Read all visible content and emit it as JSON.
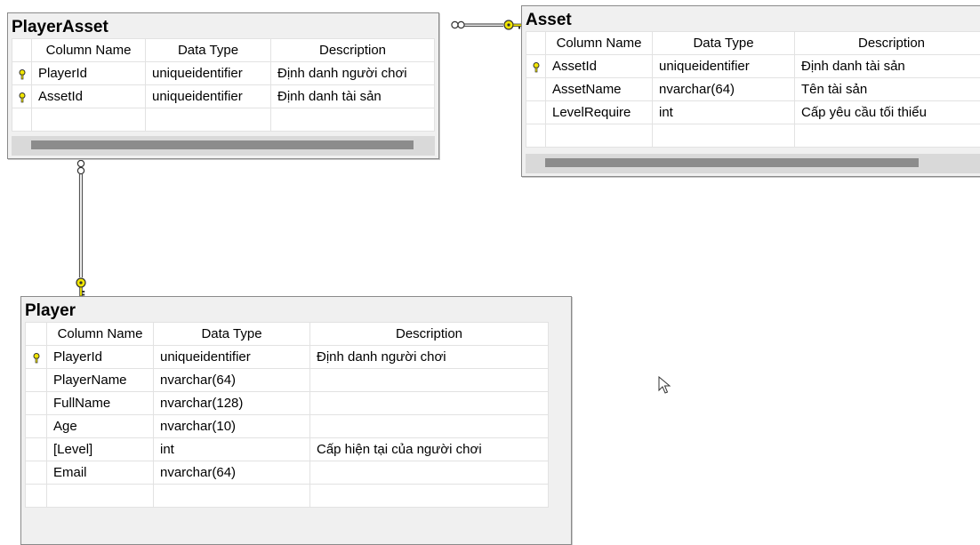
{
  "headers": {
    "col_name": "Column Name",
    "data_type": "Data Type",
    "description": "Description"
  },
  "tables": {
    "player_asset": {
      "title": "PlayerAsset",
      "rows": [
        {
          "key": true,
          "name": "PlayerId",
          "type": "uniqueidentifier",
          "desc": "Định danh người chơi"
        },
        {
          "key": true,
          "name": "AssetId",
          "type": "uniqueidentifier",
          "desc": "Định danh tài sản"
        },
        {
          "key": false,
          "name": "",
          "type": "",
          "desc": ""
        }
      ]
    },
    "asset": {
      "title": "Asset",
      "rows": [
        {
          "key": true,
          "name": "AssetId",
          "type": "uniqueidentifier",
          "desc": "Định danh tài sản"
        },
        {
          "key": false,
          "name": "AssetName",
          "type": "nvarchar(64)",
          "desc": "Tên tài sản"
        },
        {
          "key": false,
          "name": "LevelRequire",
          "type": "int",
          "desc": "Cấp yêu cầu tối thiểu"
        },
        {
          "key": false,
          "name": "",
          "type": "",
          "desc": ""
        }
      ]
    },
    "player": {
      "title": "Player",
      "rows": [
        {
          "key": true,
          "name": "PlayerId",
          "type": "uniqueidentifier",
          "desc": "Định danh người chơi"
        },
        {
          "key": false,
          "name": "PlayerName",
          "type": "nvarchar(64)",
          "desc": ""
        },
        {
          "key": false,
          "name": "FullName",
          "type": "nvarchar(128)",
          "desc": ""
        },
        {
          "key": false,
          "name": "Age",
          "type": "nvarchar(10)",
          "desc": ""
        },
        {
          "key": false,
          "name": "[Level]",
          "type": "int",
          "desc": "Cấp hiện tại của người chơi"
        },
        {
          "key": false,
          "name": "Email",
          "type": "nvarchar(64)",
          "desc": ""
        },
        {
          "key": false,
          "name": "",
          "type": "",
          "desc": ""
        }
      ]
    }
  },
  "relationships": [
    {
      "from": "PlayerAsset",
      "to": "Asset",
      "many_end": "PlayerAsset",
      "one_end": "Asset"
    },
    {
      "from": "PlayerAsset",
      "to": "Player",
      "many_end": "PlayerAsset",
      "one_end": "Player"
    }
  ],
  "icons": {
    "primary_key": "key-icon",
    "relation_one": "key-icon",
    "relation_many": "infinity-icon"
  },
  "colors": {
    "key_yellow": "#f2e600",
    "border": "#8a8a8a",
    "scroll_thumb": "#8c8c8c"
  }
}
